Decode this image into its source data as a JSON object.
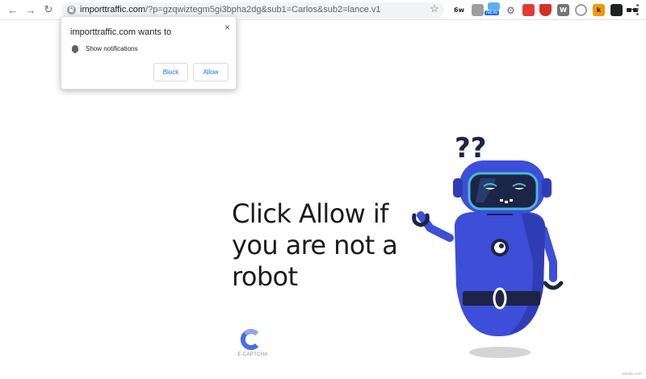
{
  "browser": {
    "url_host": "importtraffic.com",
    "url_rest": "/?p=gzqwiztegm5gi3bpha2dg&sub1=Carlos&sub2=lance.v1",
    "new_badge": "NEW",
    "extensions": [
      {
        "name": "6w-icon",
        "label": "6w",
        "color": "#202124"
      },
      {
        "name": "puzzle-icon",
        "label": "",
        "color": "#9e9e9e"
      },
      {
        "name": "new-ext-icon",
        "label": "",
        "color": "#1a73e8"
      },
      {
        "name": "gear-icon",
        "label": "⚙",
        "color": "#5f6368"
      },
      {
        "name": "red-ext-icon",
        "label": "",
        "color": "#e53935"
      },
      {
        "name": "shield-ext-icon",
        "label": "",
        "color": "#d93025"
      },
      {
        "name": "w-ext-icon",
        "label": "W",
        "color": "#757575"
      },
      {
        "name": "circle-ext-icon",
        "label": "",
        "color": "#9e9e9e"
      },
      {
        "name": "k-ext-icon",
        "label": "k",
        "color": "#f29900"
      },
      {
        "name": "dark-ext-icon",
        "label": "",
        "color": "#202124"
      },
      {
        "name": "glasses-ext-icon",
        "label": "",
        "color": "#202124"
      }
    ]
  },
  "notification": {
    "title": "importtraffic.com wants to",
    "permission": "Show notifications",
    "block_label": "Block",
    "allow_label": "Allow",
    "close_glyph": "×"
  },
  "page": {
    "headline": "Click Allow if you are not a robot",
    "captcha_label": "E-CAPTCHA",
    "watermark": "wsxdn.com"
  },
  "colors": {
    "accent": "#1a73e8",
    "robot_body": "#3d4ed8",
    "robot_dark": "#1c2447",
    "robot_visor": "#48b8d8"
  }
}
